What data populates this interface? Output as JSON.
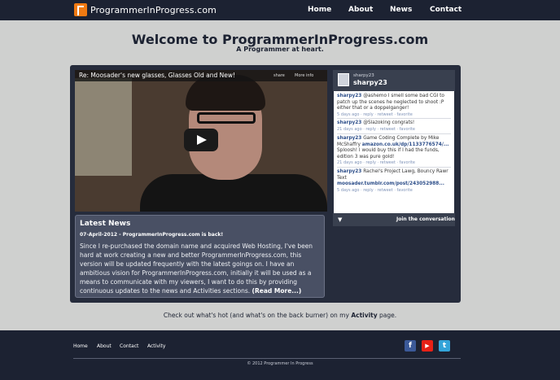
{
  "header": {
    "logo_text": "ProgrammerInProgress.com",
    "nav": [
      "Home",
      "About",
      "News",
      "Contact"
    ]
  },
  "intro": {
    "title": "Welcome to ProgrammerInProgress.com",
    "tagline": "A Programmer at heart."
  },
  "video": {
    "title": "Re: Moosader's new glasses, Glasses Old and New!",
    "share_label": "share",
    "more_info_label": "More info"
  },
  "news": {
    "heading": "Latest News",
    "date_line": "07-April-2012 - ProgrammerInProgress.com is back!",
    "body": "Since I re-purchased the domain name and acquired Web Hosting, I've been hard at work creating a new and better ProgrammerInProgress.com, this version will be updated frequently with the latest goings on. I have an ambitious vision for ProgrammerInProgress.com, initially it will be used as a means to communicate with my viewers, I want to do this by providing continuous updates to the news and Activities sections.",
    "read_more": "(Read More...)"
  },
  "twitter": {
    "handle_small": "sharpy23",
    "handle": "sharpy23",
    "tweets": [
      {
        "user": "sharpy23",
        "text": "@ashemo I smell some bad CGI to patch up the scenes he neglected to shoot :P either that or a doppelganger!",
        "link": "",
        "meta": "5 days ago · reply · retweet · favorite"
      },
      {
        "user": "sharpy23",
        "text": "@Slazoking congrats!",
        "link": "",
        "meta": "21 days ago · reply · retweet · favorite"
      },
      {
        "user": "sharpy23",
        "text": "Game Coding Complete by Mike McShaffry",
        "link": "amazon.co.uk/dp/1133776574/...",
        "text2": "Sploosh! I would buy this if I had the funds, edition 3 was pure gold!",
        "meta": "21 days ago · reply · retweet · favorite"
      },
      {
        "user": "sharpy23",
        "text": "Rachel's Project Lawg, Bouncy Rawr Text",
        "link": "moosader.tumblr.com/post/243052988...",
        "meta": "5 days ago · reply · retweet · favorite"
      }
    ],
    "join": "Join the conversation"
  },
  "promo": {
    "text_before": "Check out what's hot (and what's on the back burner) on my ",
    "link": "Activity",
    "text_after": " page."
  },
  "footer": {
    "links": [
      "Home",
      "About",
      "Contact",
      "Activity"
    ],
    "copyright": "© 2012 Programmer In Progress"
  },
  "colors": {
    "nav_bg": "#1c2232",
    "page_bg": "#cfd0cf",
    "accent_orange": "#f07a12",
    "facebook": "#3b5998",
    "youtube": "#e62117",
    "twitter": "#33a4d9"
  },
  "icons": [
    "logo-icon",
    "play-icon",
    "twitter-bird-icon",
    "facebook-icon",
    "youtube-icon",
    "twitter-icon"
  ]
}
